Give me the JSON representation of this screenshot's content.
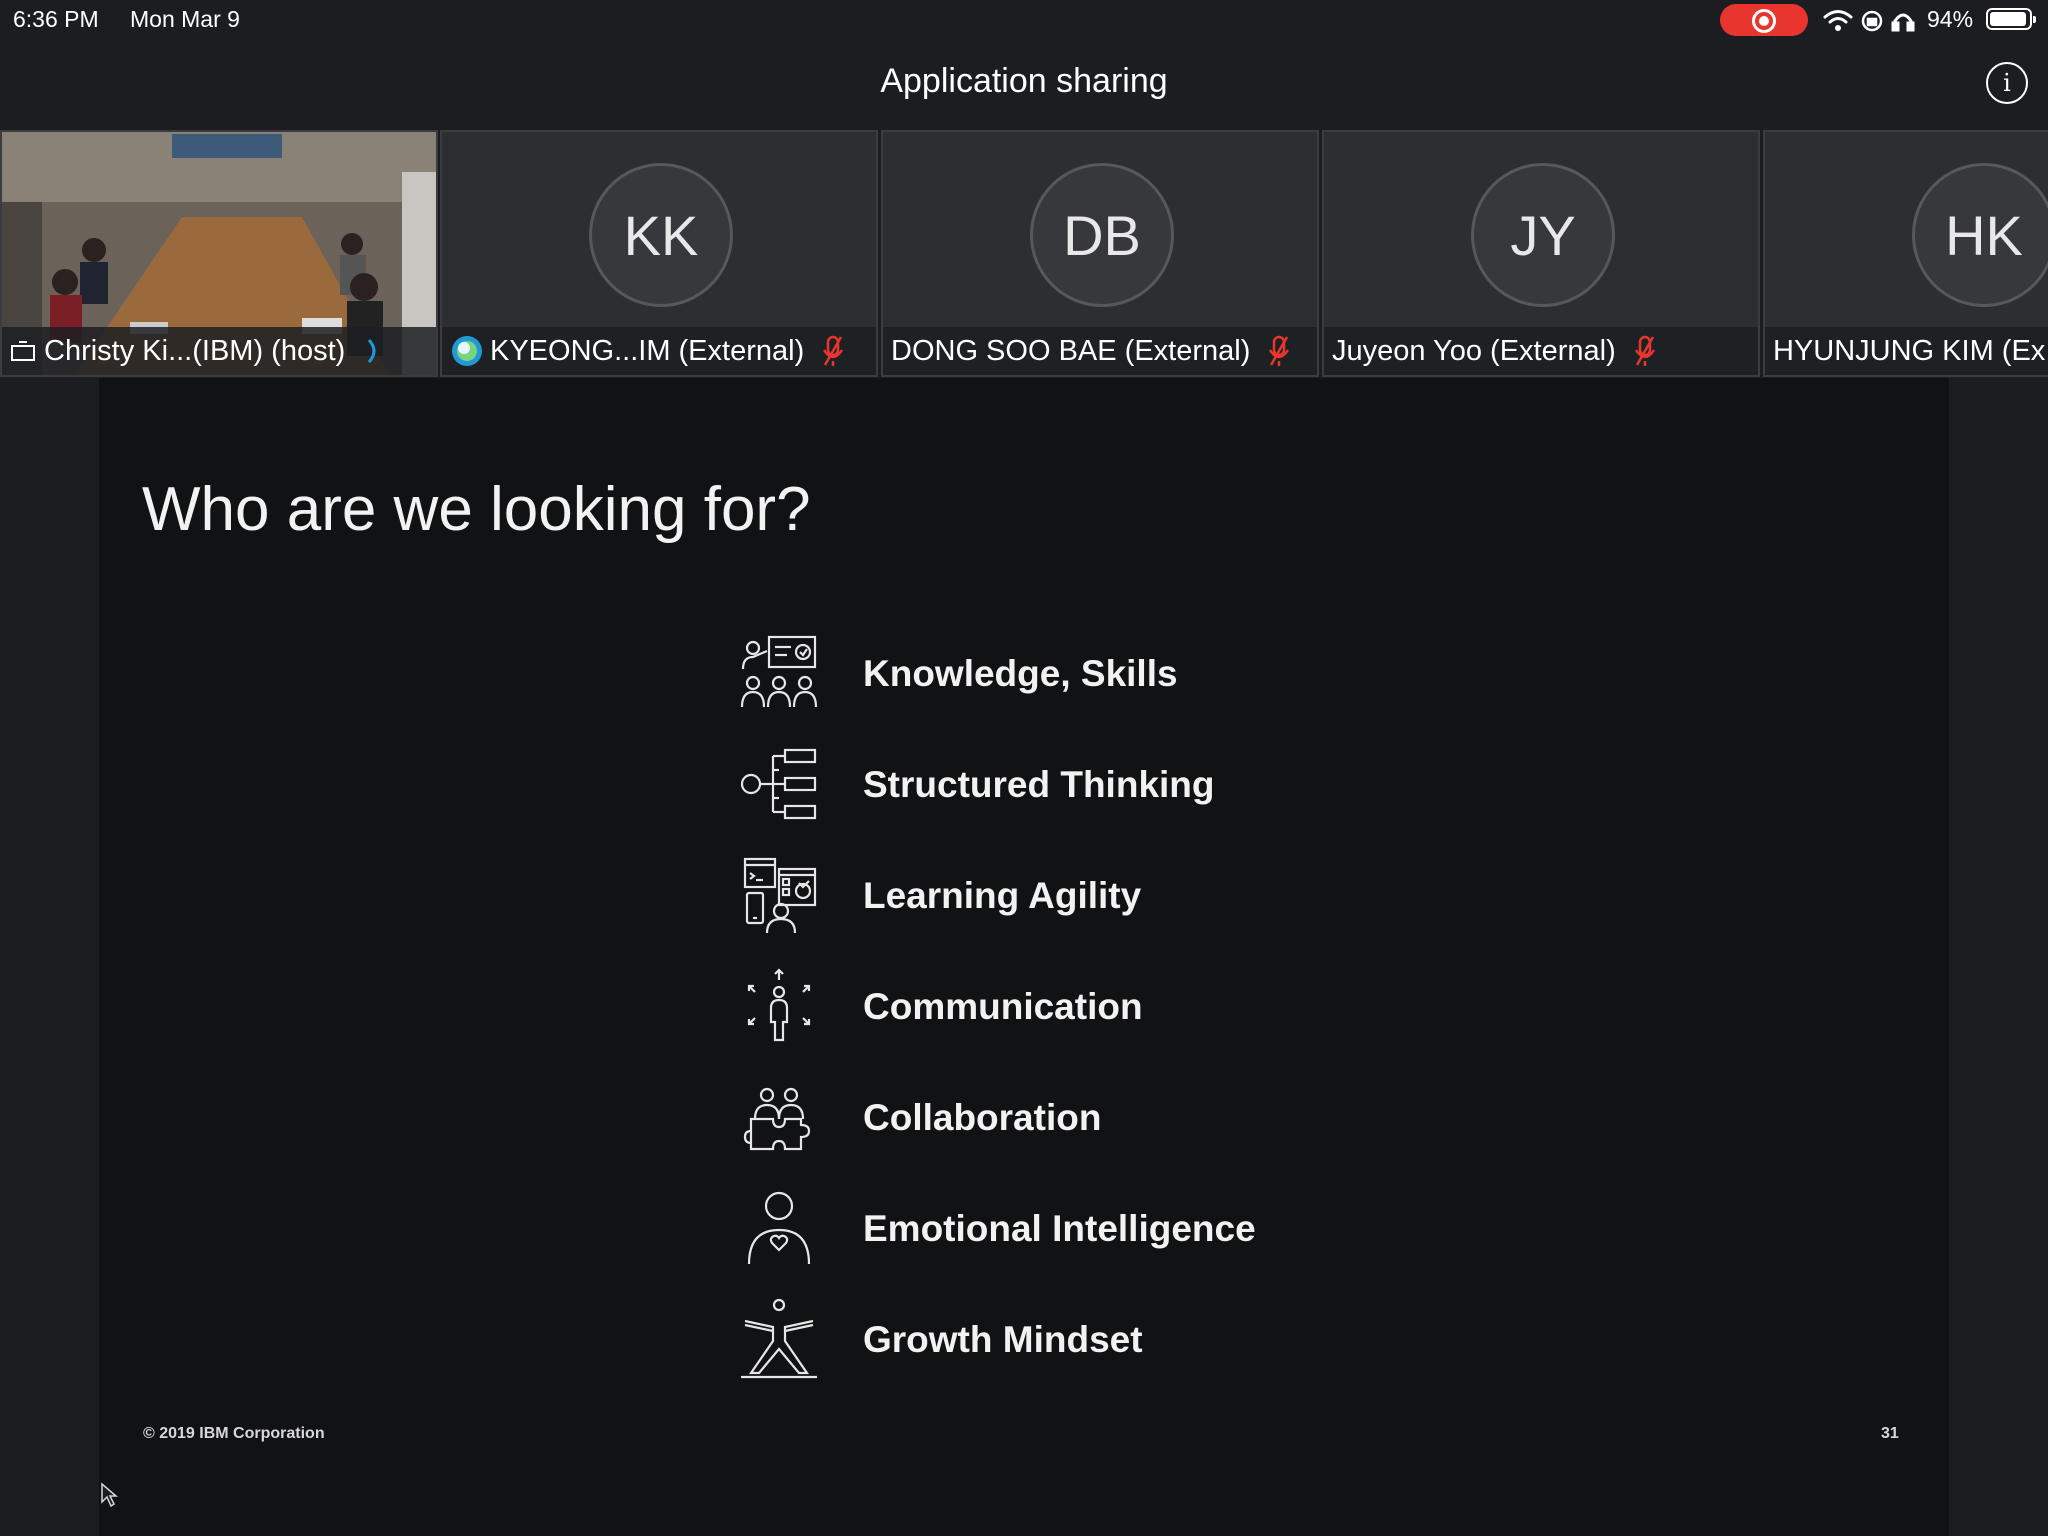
{
  "status_bar": {
    "time": "6:36 PM",
    "date": "Mon Mar 9",
    "battery_percent": "94%",
    "battery_level": 0.94,
    "icons": [
      "recording-icon",
      "wifi-icon",
      "orientation-lock-icon",
      "headphones-icon",
      "battery-icon"
    ],
    "recording_color": "#e8352e"
  },
  "header": {
    "title": "Application sharing",
    "info_icon": "info-icon"
  },
  "participants": [
    {
      "name": "Christy Ki...(IBM) (host)",
      "type": "video",
      "speaking": true
    },
    {
      "name": "KYEONG...IM (External)",
      "initials": "KK",
      "muted": true
    },
    {
      "name": "DONG SOO BAE (External)",
      "initials": "DB",
      "muted": true
    },
    {
      "name": "Juyeon Yoo (External)",
      "initials": "JY",
      "muted": true
    },
    {
      "name": "HYUNJUNG KIM (Ex",
      "initials": "HK"
    }
  ],
  "slide": {
    "title": "Who are we looking for?",
    "items": [
      {
        "label": "Knowledge, Skills",
        "icon": "teaching-group-icon"
      },
      {
        "label": "Structured Thinking",
        "icon": "hierarchy-tree-icon"
      },
      {
        "label": "Learning Agility",
        "icon": "devices-learner-icon"
      },
      {
        "label": "Communication",
        "icon": "person-broadcast-icon"
      },
      {
        "label": "Collaboration",
        "icon": "puzzle-people-icon"
      },
      {
        "label": "Emotional Intelligence",
        "icon": "person-heart-icon"
      },
      {
        "label": "Growth Mindset",
        "icon": "yoga-pose-icon"
      }
    ],
    "footer": "© 2019 IBM Corporation",
    "page_number": "31"
  },
  "colors": {
    "app_background": "#1b1d21",
    "slide_background": "#111214",
    "muted_mic": "#e8352e",
    "speaking_indicator": "#1e9bd7"
  }
}
